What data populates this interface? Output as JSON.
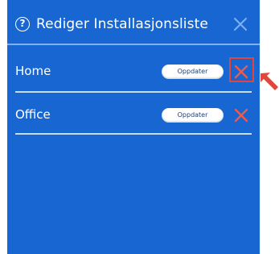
{
  "dialog": {
    "title": "Rediger Installasjonsliste",
    "help_icon": "question-circle-icon",
    "close_icon": "close-icon"
  },
  "locations": [
    {
      "name": "Home",
      "update_label": "Oppdater",
      "delete_icon": "delete-x-icon",
      "highlighted": true
    },
    {
      "name": "Office",
      "update_label": "Oppdater",
      "delete_icon": "delete-x-icon",
      "highlighted": false
    }
  ],
  "colors": {
    "panel_background": "#1866d2",
    "delete_icon": "#f05a4a",
    "highlight": "#e0473a",
    "header_divider": "#7fb0f0",
    "row_divider": "#c9dcf6"
  },
  "annotation": {
    "pointer_icon": "red-pointer-arrow-icon"
  }
}
